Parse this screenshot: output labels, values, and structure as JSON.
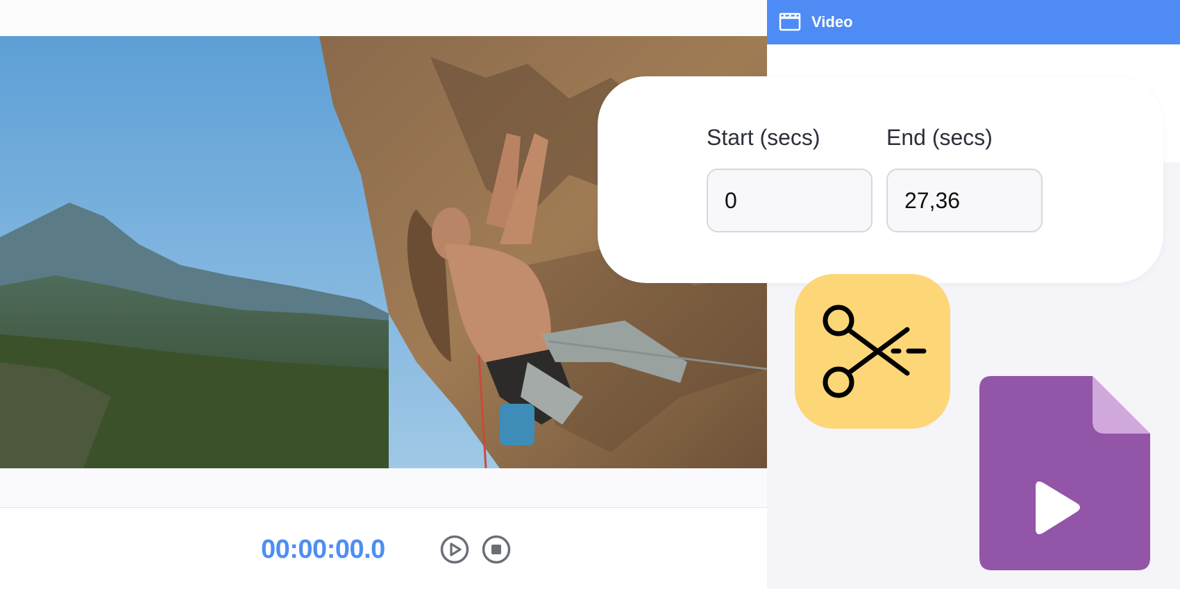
{
  "header": {
    "title": "Video",
    "icon": "clapperboard-icon",
    "color": "#4f8bf5"
  },
  "trim": {
    "start_label": "Start (secs)",
    "end_label": "End (secs)",
    "start_value": "0",
    "end_value": "27,36"
  },
  "player": {
    "timecode": "00:00:00.0",
    "timecode_color": "#4d8ef4",
    "play_icon": "play-circle-icon",
    "stop_icon": "stop-circle-icon"
  },
  "decor": {
    "scissors_icon": "scissors-icon",
    "scissors_tile_color": "#fdd677",
    "file_icon": "video-file-icon",
    "file_color": "#9355a7"
  }
}
